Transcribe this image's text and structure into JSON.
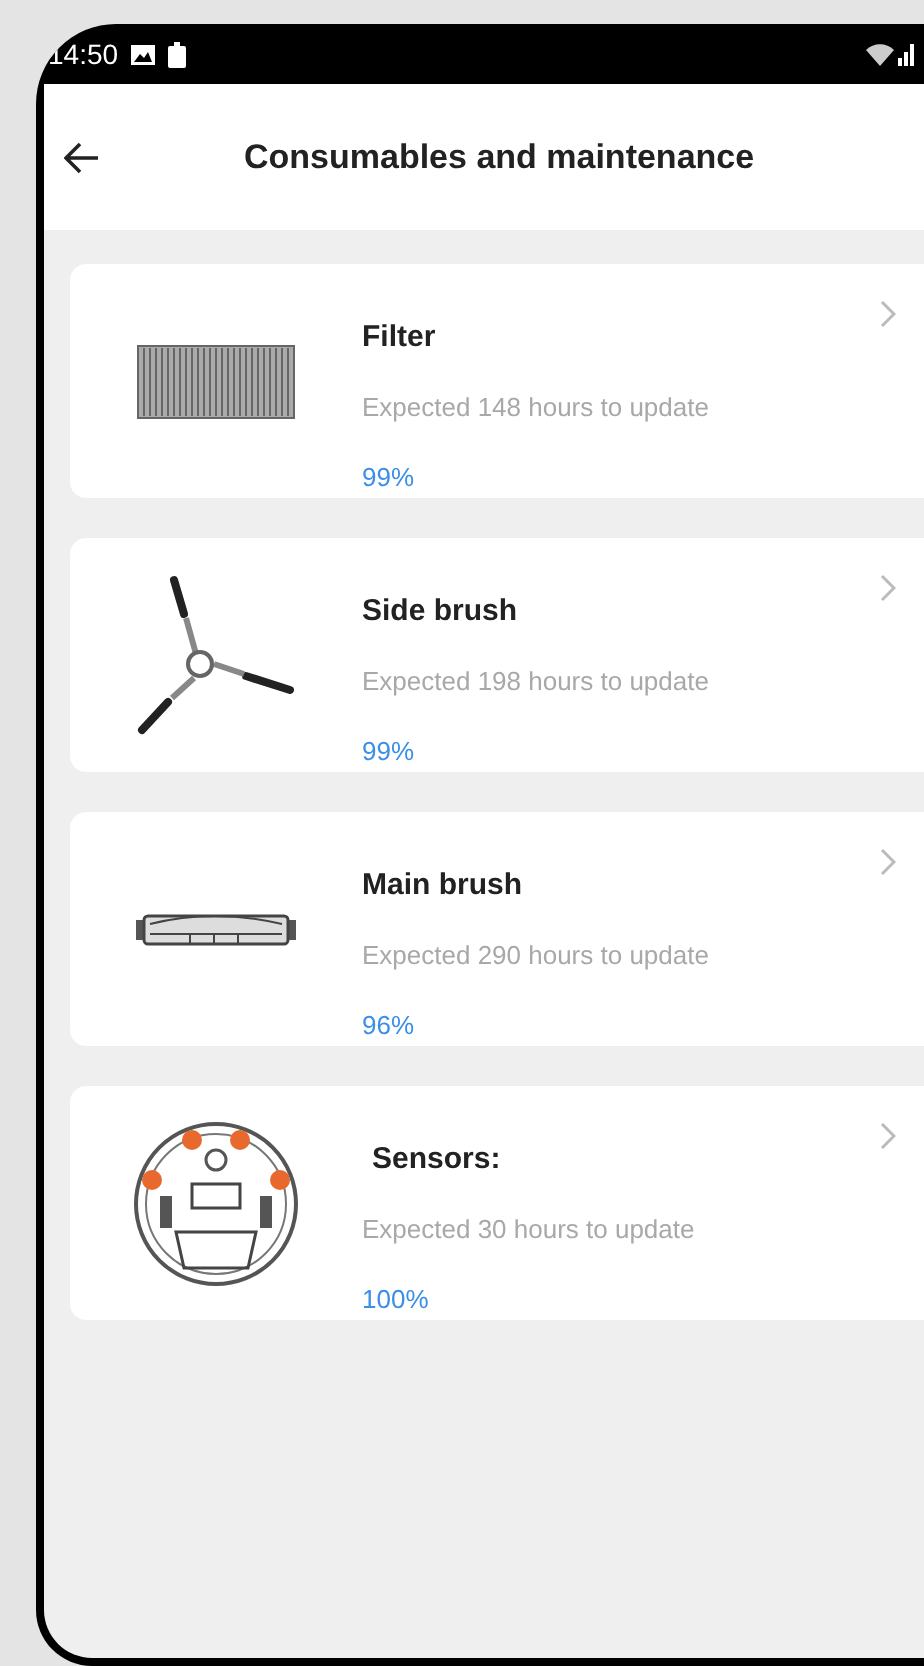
{
  "status_bar": {
    "time": "14:50"
  },
  "header": {
    "title": "Consumables and maintenance"
  },
  "items": [
    {
      "kind": "filter",
      "name": "Filter",
      "expected": "Expected 148 hours to update",
      "percent": "99%"
    },
    {
      "kind": "side_brush",
      "name": "Side brush",
      "expected": "Expected 198 hours to update",
      "percent": "99%"
    },
    {
      "kind": "main_brush",
      "name": "Main brush",
      "expected": "Expected 290 hours to update",
      "percent": "96%"
    },
    {
      "kind": "sensors",
      "name": "Sensors:",
      "expected": "Expected 30 hours to update",
      "percent": "100%"
    }
  ]
}
